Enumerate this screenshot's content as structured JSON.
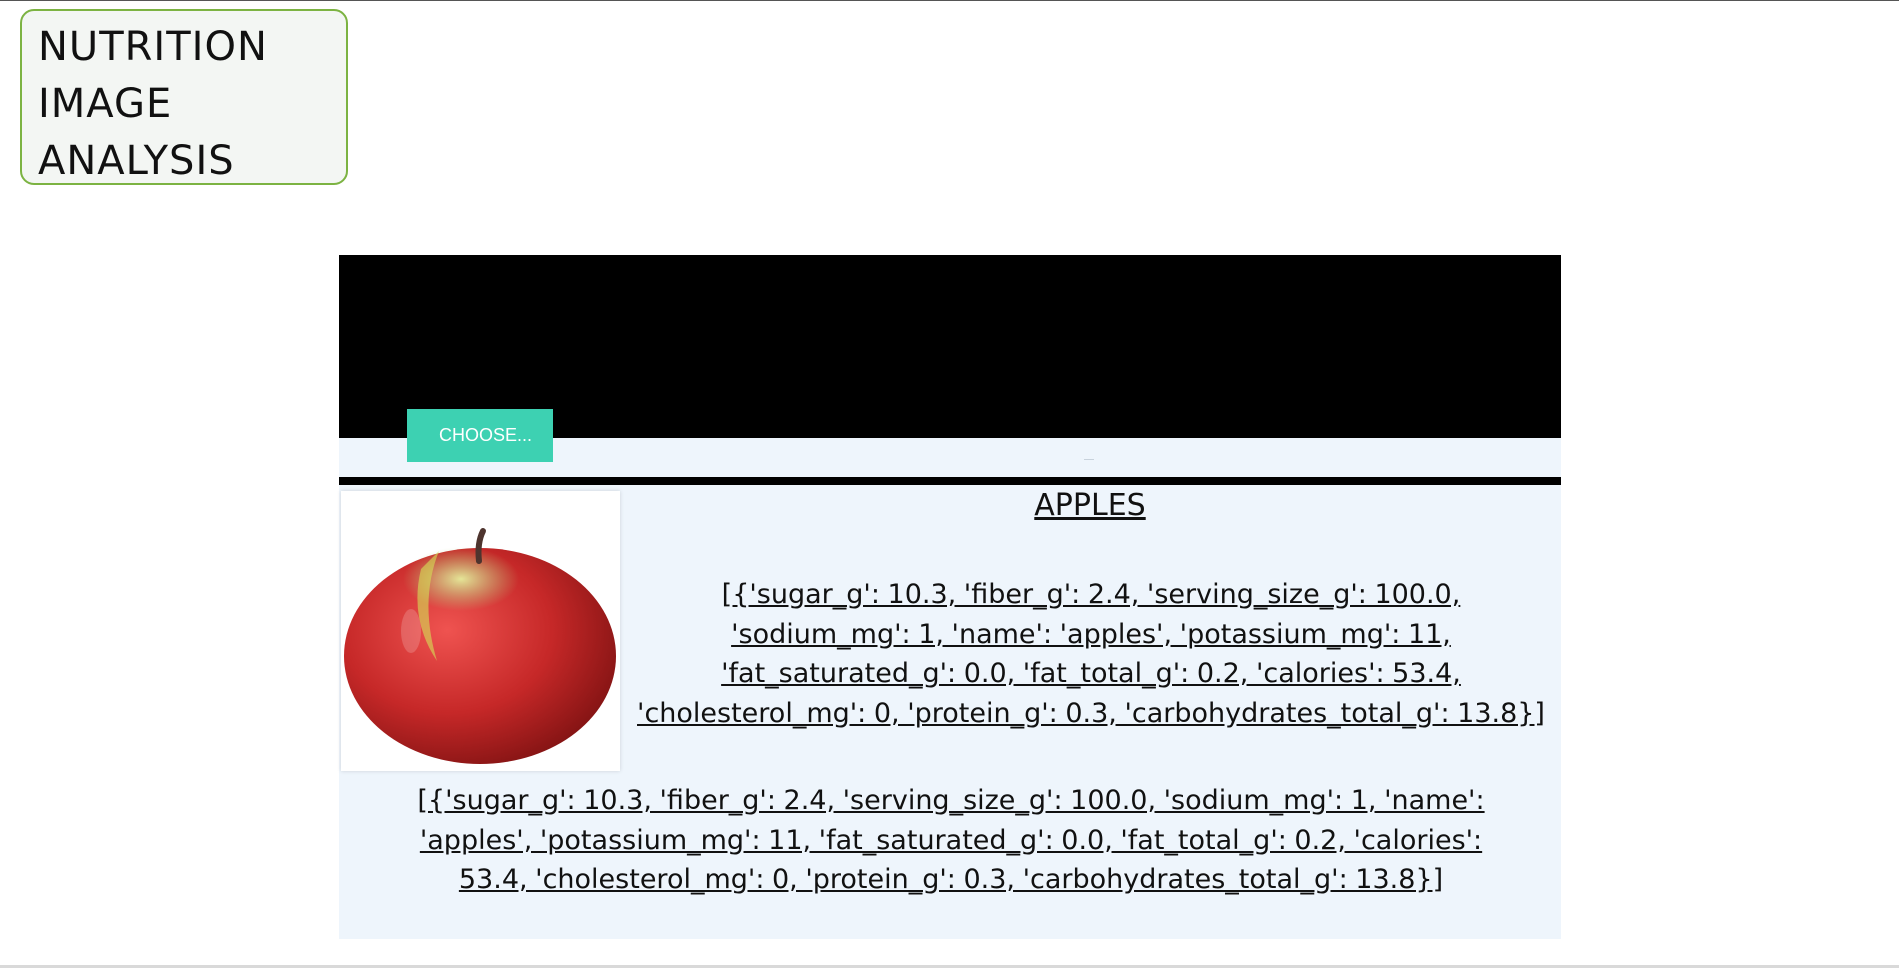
{
  "brand": {
    "lines": [
      "NUTRITION",
      "IMAGE",
      "ANALYSIS"
    ]
  },
  "upload": {
    "choose_label": "CHOOSE..."
  },
  "result": {
    "food_name": "APPLES",
    "image_alt": "Red apple",
    "nutrition_text_1": "[{'sugar_g': 10.3, 'fiber_g': 2.4, 'serving_size_g': 100.0, 'sodium_mg': 1, 'name': 'apples', 'potassium_mg': 11, 'fat_saturated_g': 0.0, 'fat_total_g': 0.2, 'calories': 53.4, 'cholesterol_mg': 0, 'protein_g': 0.3, 'carbohydrates_total_g': 13.8}]",
    "nutrition_text_2": "[{'sugar_g': 10.3, 'fiber_g': 2.4, 'serving_size_g': 100.0, 'sodium_mg': 1, 'name': 'apples', 'potassium_mg': 11, 'fat_saturated_g': 0.0, 'fat_total_g': 0.2, 'calories': 53.4, 'cholesterol_mg': 0, 'protein_g': 0.3, 'carbohydrates_total_g': 13.8}]"
  },
  "colors": {
    "brand_border": "#7cb342",
    "hero_background": "#000000",
    "button": "#3dd1b2",
    "panel_background": "#eef5fc",
    "apple_red": "#c62828"
  }
}
